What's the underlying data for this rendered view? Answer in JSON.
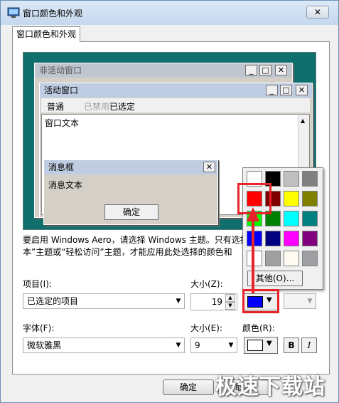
{
  "window": {
    "title": "窗口颜色和外观",
    "close_label": "✕"
  },
  "tab": {
    "label": "窗口颜色和外观"
  },
  "preview": {
    "inactive_title": "非活动窗口",
    "active_title": "活动窗口",
    "menu": [
      "普通",
      "已禁用",
      "已选定"
    ],
    "window_text": "窗口文本",
    "msgbox_title": "消息框",
    "msgbox_text": "消息文本",
    "msgbox_ok": "确定",
    "btn_min": "_",
    "btn_max": "□",
    "btn_close": "✕"
  },
  "description": {
    "line1": "要启用 Windows Aero，请选择 Windows 主题。只有选择",
    "line2": "本”主题或“轻松访问”主题，才能应用此处选择的颜色和"
  },
  "item": {
    "label": "项目(I):",
    "value": "已选定的项目"
  },
  "size1": {
    "label": "大小(Z):",
    "value": "19"
  },
  "size2": {
    "label": "大小(E):",
    "value": "9"
  },
  "font": {
    "label": "字体(F):",
    "value": "微软雅黑"
  },
  "color": {
    "label": "颜色(R):"
  },
  "format": {
    "bold": "B",
    "italic": "I"
  },
  "colors": {
    "item_color1": "#0000ff",
    "font_color": "#ffffff",
    "palette": [
      "#ffffff",
      "#000000",
      "#c0c0c0",
      "#808080",
      "#ff0000",
      "#800000",
      "#ffff00",
      "#808000",
      "#00ff00",
      "#008000",
      "#00ffff",
      "#008080",
      "#0000ff",
      "#000080",
      "#ff00ff",
      "#800080",
      "#ffffff",
      "#a0a0a0",
      "#fffbf0",
      "#a0a0a4"
    ],
    "highlight": "#e8232a",
    "preview_bg": "#0f6f6c"
  },
  "popup": {
    "other_label": "其他(O)..."
  },
  "buttons": {
    "ok": "确定",
    "cancel": "取消"
  },
  "watermark": "极速下载站"
}
